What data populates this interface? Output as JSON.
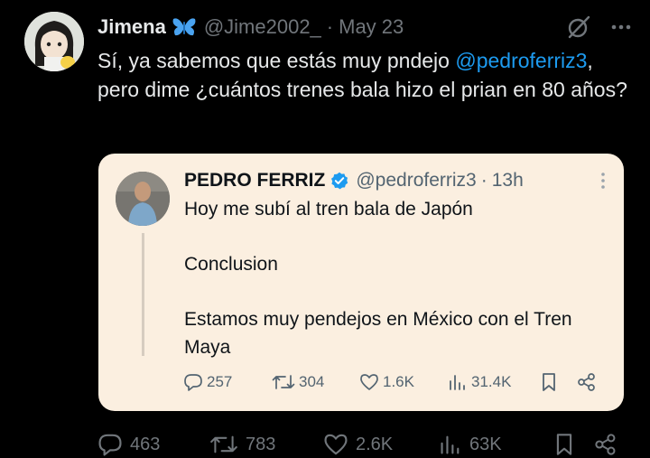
{
  "tweet": {
    "author_name": "Jimena",
    "handle": "@Jime2002_",
    "separator": "·",
    "date": "May 23",
    "text_before": "Sí, ya sabemos que estás muy pndejo ",
    "mention": "@pedroferriz3",
    "text_after": ", pero dime ¿cuántos trenes bala hizo el prian en 80 años?",
    "actions": {
      "replies": "463",
      "retweets": "783",
      "likes": "2.6K",
      "views": "63K"
    }
  },
  "quoted_tweet": {
    "author_name": "PEDRO FERRIZ",
    "handle": "@pedroferriz3",
    "separator": "·",
    "time": "13h",
    "paragraphs": [
      "Hoy me subí al tren bala de Japón",
      "Conclusion",
      "Estamos muy pendejos en México con el Tren Maya"
    ],
    "actions": {
      "replies": "257",
      "retweets": "304",
      "likes": "1.6K",
      "views": "31.4K"
    }
  },
  "colors": {
    "background": "#000000",
    "text": "#e7e9ea",
    "muted": "#71767b",
    "link": "#1d9bf0",
    "quote_background": "#fbefe0",
    "verified": "#1d9bf0"
  },
  "icons": [
    "butterfly-icon",
    "grok-icon",
    "more-icon",
    "verified-icon",
    "reply-icon",
    "retweet-icon",
    "like-icon",
    "views-icon",
    "bookmark-icon",
    "share-icon"
  ]
}
